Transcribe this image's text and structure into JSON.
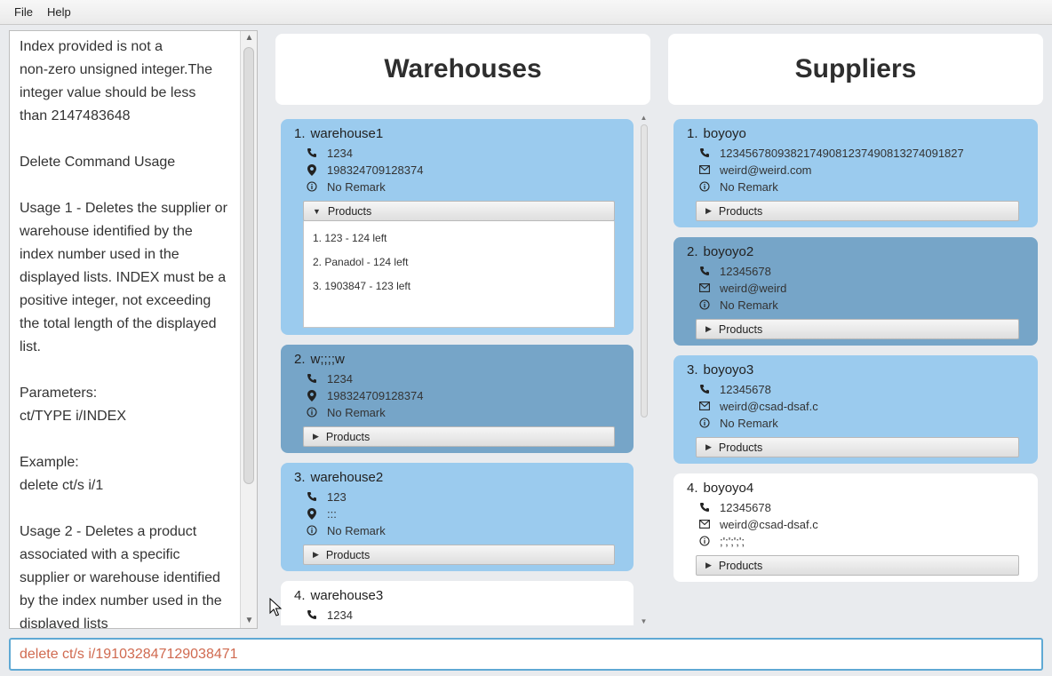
{
  "menu": [
    "File",
    "Help"
  ],
  "result": {
    "text": "Index provided is not a\nnon-zero unsigned integer.The\ninteger value should be less\nthan 2147483648\n\nDelete Command Usage\n\nUsage 1 - Deletes the supplier or\nwarehouse identified by the\nindex number used in the\ndisplayed lists. INDEX must be a\npositive integer, not exceeding\nthe total length of the displayed\nlist.\n\nParameters:\nct/TYPE i/INDEX\n\nExample:\ndelete ct/s i/1\n\nUsage 2 - Deletes a product\nassociated with a specific\nsupplier or warehouse identified\nby the index number used in the\ndisplayed lists"
  },
  "warehouses": {
    "header": "Warehouses",
    "items": [
      {
        "num": "1.",
        "name": "warehouse1",
        "phone": "1234",
        "address": "198324709128374",
        "remark": "No Remark",
        "products_label": "Products",
        "expanded": true,
        "products": [
          "1. 123 - 124 left",
          "2. Panadol - 124 left",
          "3. 1903847 - 123 left"
        ]
      },
      {
        "num": "2.",
        "name": "w;;;;w",
        "phone": "1234",
        "address": "198324709128374",
        "remark": "No Remark",
        "products_label": "Products"
      },
      {
        "num": "3.",
        "name": "warehouse2",
        "phone": "123",
        "address": ":::",
        "remark": "No Remark",
        "products_label": "Products"
      },
      {
        "num": "4.",
        "name": "warehouse3",
        "phone": "1234"
      }
    ]
  },
  "suppliers": {
    "header": "Suppliers",
    "items": [
      {
        "num": "1.",
        "name": "boyoyo",
        "phone": "12345678093821749081237490813274091827",
        "email": "weird@weird.com",
        "remark": "No Remark",
        "products_label": "Products"
      },
      {
        "num": "2.",
        "name": "boyoyo2",
        "phone": "12345678",
        "email": "weird@weird",
        "remark": "No Remark",
        "products_label": "Products"
      },
      {
        "num": "3.",
        "name": "boyoyo3",
        "phone": "12345678",
        "email": "weird@csad-dsaf.c",
        "remark": "No Remark",
        "products_label": "Products"
      },
      {
        "num": "4.",
        "name": "boyoyo4",
        "phone": "12345678",
        "email": "weird@csad-dsaf.c",
        "remark": ";';';';';",
        "products_label": "Products"
      }
    ]
  },
  "command": {
    "value": "delete ct/s i/191032847129038471"
  },
  "colors": {
    "card_light": "#9bcbee",
    "card_dark": "#76a5c8",
    "command_text": "#d06a50",
    "command_border": "#5fa9d4"
  }
}
